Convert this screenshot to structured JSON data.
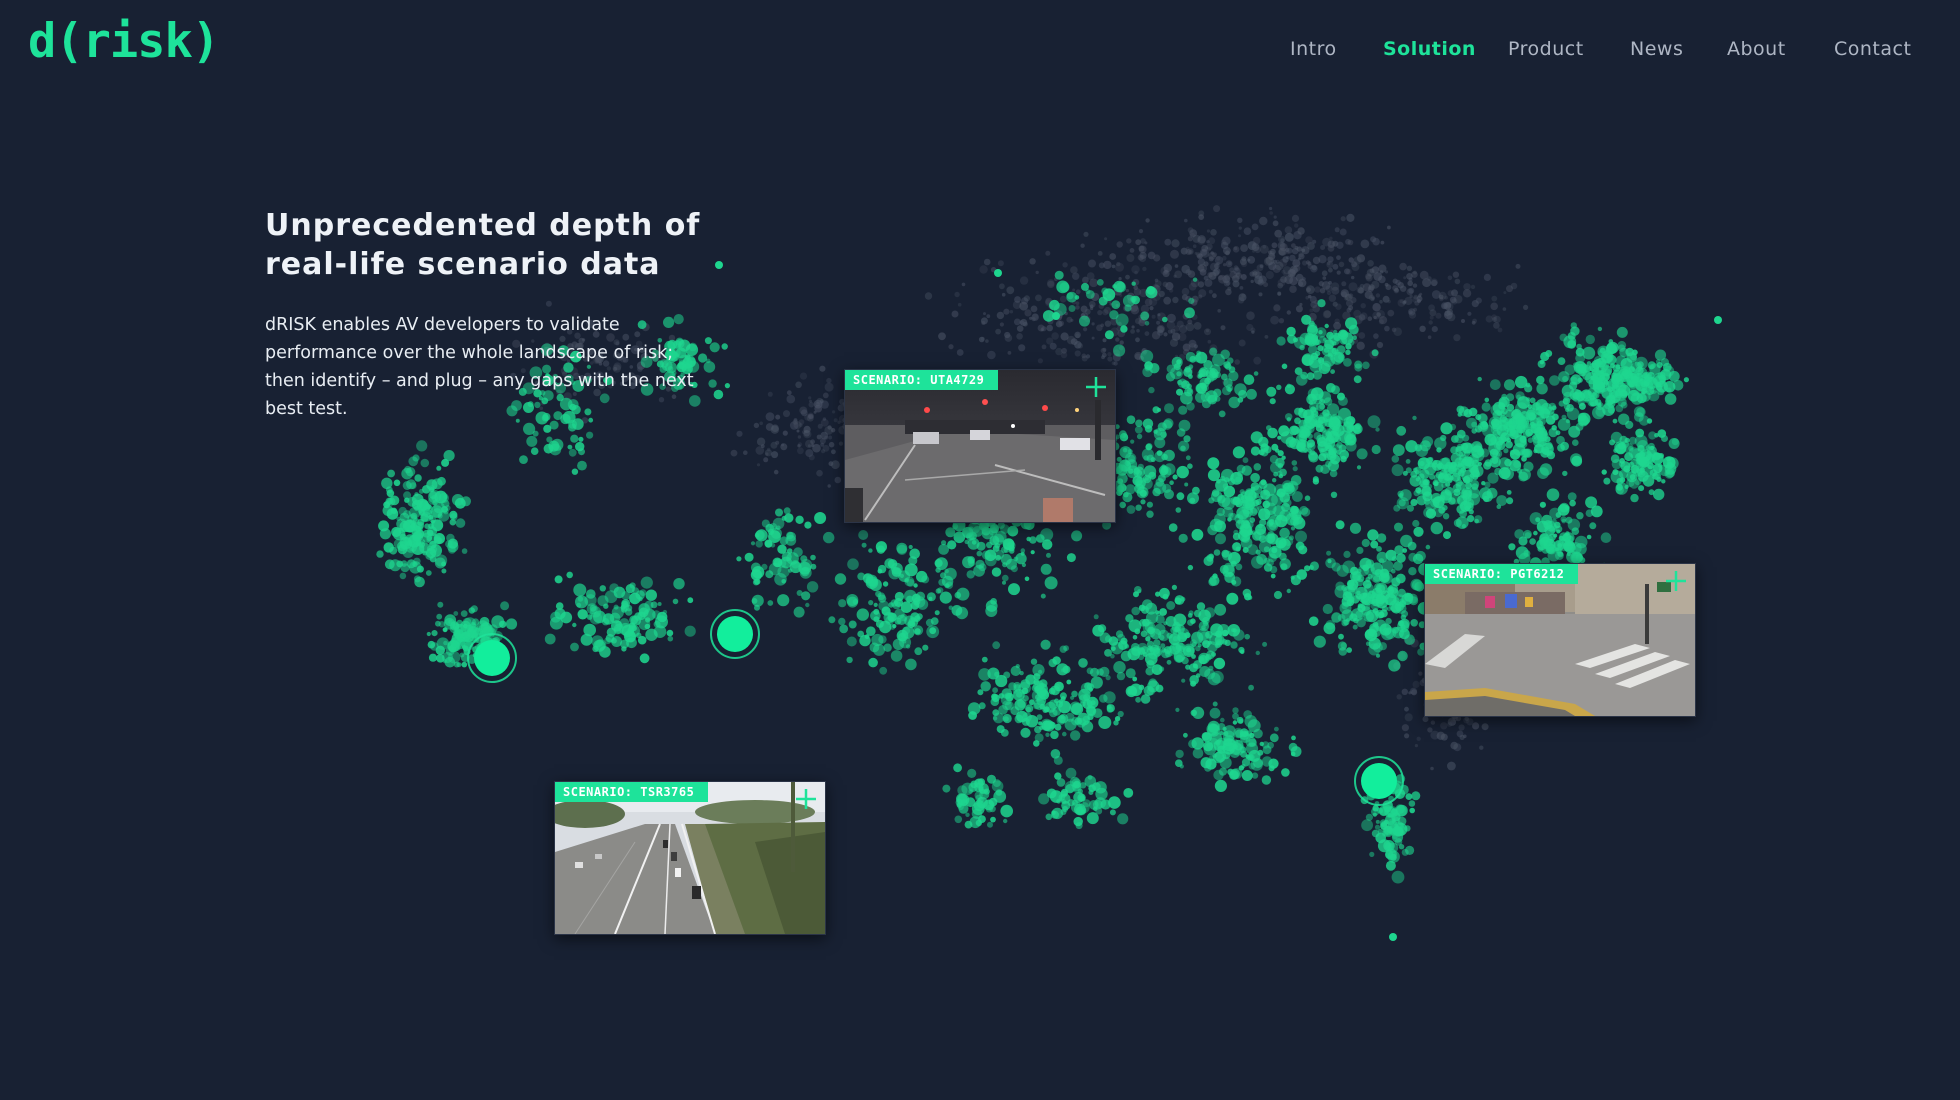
{
  "brand": {
    "logo_text": "d(risk)",
    "accent_color": "#1ee39a",
    "background_color": "#182133"
  },
  "nav": {
    "items": [
      {
        "label": "Intro",
        "active": false
      },
      {
        "label": "Solution",
        "active": true
      },
      {
        "label": "Product",
        "active": false
      },
      {
        "label": "News",
        "active": false
      },
      {
        "label": "About",
        "active": false
      },
      {
        "label": "Contact",
        "active": false
      }
    ]
  },
  "hero": {
    "title_line1": "Unprecedented depth of",
    "title_line2": "real-life scenario data",
    "body_line1": "dRISK enables AV developers to validate",
    "body_line2": "performance over the whole landscape of risk;",
    "body_line3": "then identify – and plug – any gaps with the next",
    "body_line4": "best test."
  },
  "scenarios": [
    {
      "label": "SCENARIO: UTA4729",
      "scene": "night-intersection",
      "plus_icon": "plus-icon"
    },
    {
      "label": "SCENARIO: PGT6212",
      "scene": "crosswalk-street",
      "plus_icon": "plus-icon"
    },
    {
      "label": "SCENARIO: TSR3765",
      "scene": "highway-aerial",
      "plus_icon": "plus-icon"
    }
  ],
  "hotspots": [
    {
      "name": "hotspot-california"
    },
    {
      "name": "hotspot-arizona"
    },
    {
      "name": "hotspot-florida"
    }
  ]
}
